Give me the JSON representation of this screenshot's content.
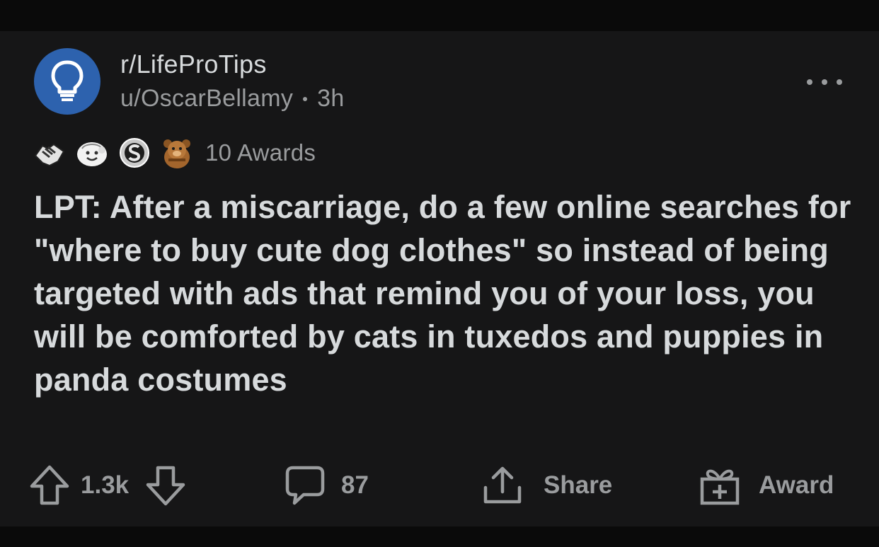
{
  "post": {
    "subreddit": "r/LifeProTips",
    "author": "u/OscarBellamy",
    "age": "3h",
    "awards_count": "10 Awards",
    "title": "LPT: After a miscarriage, do a few online searches for \"where to buy cute dog clothes\" so instead of being targeted with ads that remind you of your loss, you will be comforted by cats in tuxedos and puppies in panda costumes"
  },
  "actions": {
    "votes": "1.3k",
    "comments": "87",
    "share": "Share",
    "award": "Award"
  },
  "icons": {
    "avatar": "lightbulb-icon",
    "more": "more-options-icon",
    "awards": [
      "handshake-award-icon",
      "wholesome-award-icon",
      "silver-award-icon",
      "bear-award-icon"
    ],
    "upvote": "upvote-arrow-icon",
    "downvote": "downvote-arrow-icon",
    "comment": "comment-bubble-icon",
    "share": "share-icon",
    "award": "gift-icon"
  },
  "colors": {
    "background": "#0a0a0a",
    "card": "#161617",
    "avatar": "#2d62ae",
    "text_primary": "#d7dadc",
    "text_secondary": "#9a9c9e"
  }
}
